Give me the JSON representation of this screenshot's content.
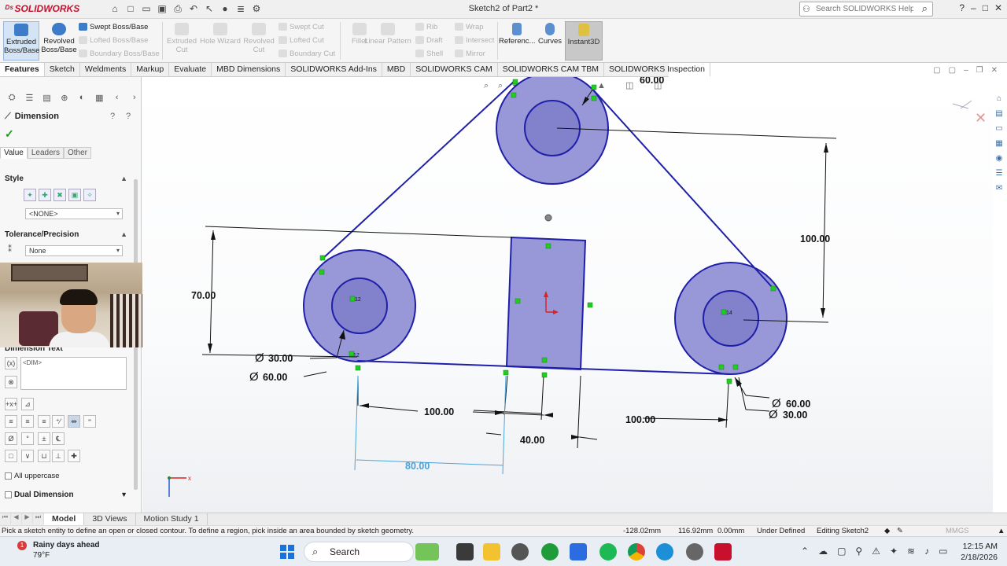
{
  "app": {
    "logo": "SOLIDWORKS",
    "title": "Sketch2 of Part2 *"
  },
  "search": {
    "placeholder": "Search SOLIDWORKS Help"
  },
  "ribbon": {
    "extruded_boss": "Extruded Boss/Base",
    "revolved_boss": "Revolved Boss/Base",
    "col1": [
      "Swept Boss/Base",
      "Lofted Boss/Base",
      "Boundary Boss/Base"
    ],
    "extruded_cut": "Extruded Cut",
    "hole_wizard": "Hole Wizard",
    "revolved_cut": "Revolved Cut",
    "col2": [
      "Swept Cut",
      "Lofted Cut",
      "Boundary Cut"
    ],
    "fillet": "Fillet",
    "linear_pattern": "Linear Pattern",
    "col3": [
      "Rib",
      "Draft",
      "Shell"
    ],
    "col4": [
      "Wrap",
      "Intersect",
      "Mirror"
    ],
    "reference": "Referenc...",
    "curves": "Curves",
    "instant3d": "Instant3D"
  },
  "tabs": [
    "Features",
    "Sketch",
    "Weldments",
    "Markup",
    "Evaluate",
    "MBD Dimensions",
    "SOLIDWORKS Add-Ins",
    "MBD",
    "SOLIDWORKS CAM",
    "SOLIDWORKS CAM TBM",
    "SOLIDWORKS Inspection"
  ],
  "panel": {
    "title": "Dimension",
    "subtabs": [
      "Value",
      "Leaders",
      "Other"
    ],
    "style_label": "Style",
    "style_value": "<NONE>",
    "tolerance_label": "Tolerance/Precision",
    "tolerance_value": "None",
    "dimtext_label": "Dimension Text",
    "dimtext_value": "<DIM>",
    "all_uppercase": "All uppercase",
    "dual_dimension": "Dual Dimension"
  },
  "dimensions": {
    "d_top_100": "100.00",
    "d_left_70": "70.00",
    "d_dia30_left": "30.00",
    "d_dia60_left": "60.00",
    "d_horiz_100_left": "100.00",
    "d_horiz_100_right": "100.00",
    "d_40": "40.00",
    "d_80": "80.00",
    "d_dia60_right": "60.00",
    "d_dia30_right": "30.00",
    "d_top_partial": "60.00",
    "dia_symbol": "Ø"
  },
  "bottom_tabs": [
    "Model",
    "3D Views",
    "Motion Study 1"
  ],
  "status": {
    "message": "Pick a sketch entity to define an open or closed contour. To define a region, pick inside an area bounded by sketch geometry.",
    "x": "-128.02mm",
    "y": "116.92mm",
    "z": "0.00mm",
    "state": "Under Defined",
    "editing": "Editing Sketch2",
    "units": "MMGS"
  },
  "taskbar": {
    "weather_title": "Rainy days ahead",
    "weather_temp": "79°F",
    "weather_badge": "1",
    "search": "Search",
    "time": "12:15 AM",
    "date": "2/18/2026"
  },
  "colors": {
    "sketch_blue": "#1f1fa8",
    "fill": "#9a9ad8",
    "relation_green": "#22cc22",
    "accent_red": "#c8102e"
  }
}
